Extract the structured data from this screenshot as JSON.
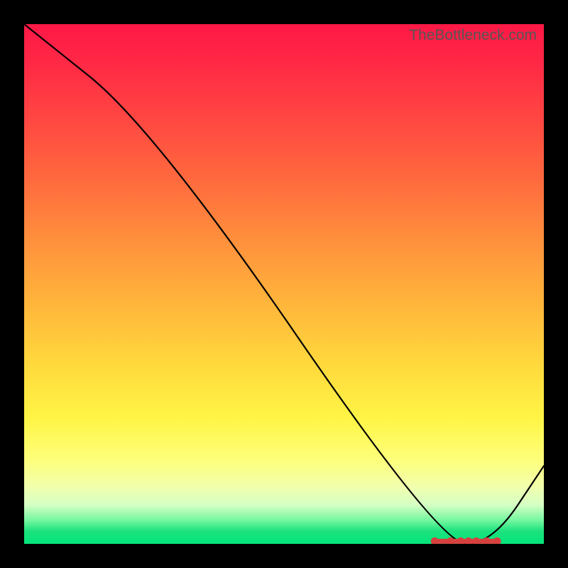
{
  "attribution": "TheBottleneck.com",
  "chart_data": {
    "type": "line",
    "title": "",
    "xlabel": "",
    "ylabel": "",
    "xlim": [
      0,
      100
    ],
    "ylim": [
      0,
      100
    ],
    "series": [
      {
        "name": "curve",
        "x": [
          0,
          25,
          80,
          90,
          100
        ],
        "y": [
          100,
          80,
          0,
          0,
          15
        ]
      }
    ],
    "optimal_band": {
      "x_start": 79,
      "x_end": 91,
      "y": 0.5
    },
    "markers": [
      {
        "x": 79,
        "y": 0.5
      },
      {
        "x": 82,
        "y": 0.5
      },
      {
        "x": 84,
        "y": 0.5
      },
      {
        "x": 85.5,
        "y": 0.5
      },
      {
        "x": 87,
        "y": 0.5
      },
      {
        "x": 89,
        "y": 0.5
      },
      {
        "x": 91,
        "y": 0.5
      }
    ],
    "gradient_stops": [
      {
        "pct": 0,
        "color": "#ff1846"
      },
      {
        "pct": 50,
        "color": "#ffc93b"
      },
      {
        "pct": 80,
        "color": "#fcff60"
      },
      {
        "pct": 100,
        "color": "#02e47a"
      }
    ]
  }
}
